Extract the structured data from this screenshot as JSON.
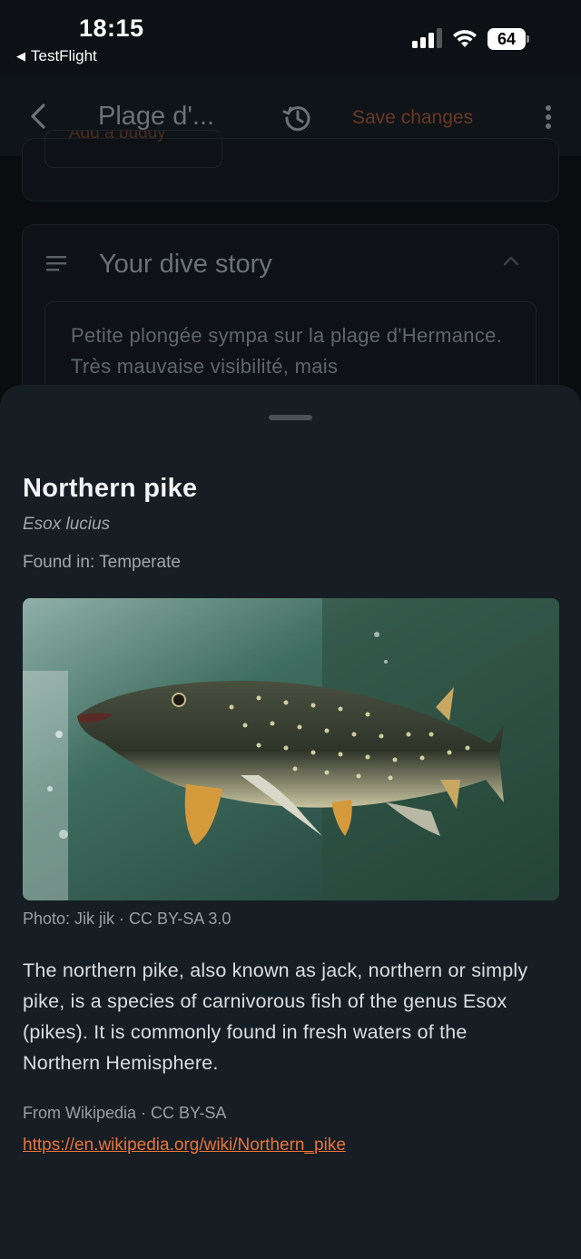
{
  "status_bar": {
    "time": "18:15",
    "back_app": "TestFlight",
    "battery": "64"
  },
  "header": {
    "title": "Plage d'...",
    "save_label": "Save changes"
  },
  "background": {
    "buddy_button": "Add a buddy",
    "story_title": "Your dive story",
    "story_text": "Petite plongée sympa sur la plage d'Hermance. Très mauvaise visibilité, mais"
  },
  "sheet": {
    "name": "Northern pike",
    "latin": "Esox lucius",
    "found_in": "Found in: Temperate",
    "photo_credit": "Photo: Jik jik · CC BY-SA 3.0",
    "description": "The northern pike, also known as jack, northern or simply pike, is a species of carnivorous fish of the genus Esox (pikes). It is commonly found in fresh waters of the Northern Hemisphere.",
    "source": "From Wikipedia · CC BY-SA",
    "link": "https://en.wikipedia.org/wiki/Northern_pike"
  },
  "colors": {
    "accent": "#e8743a",
    "sheet_bg": "#161d23",
    "app_bg": "#0a0d10"
  }
}
